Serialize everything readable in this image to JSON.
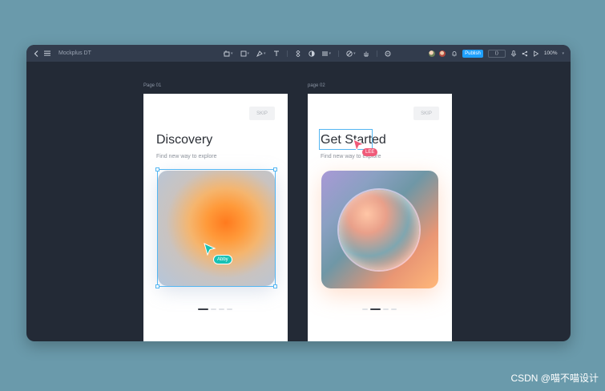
{
  "app": {
    "name": "Mockplus DT",
    "publish_label": "Publish",
    "code_label": "⟨⟩",
    "zoom": "100%"
  },
  "toolbar_icons": [
    "back-icon",
    "menu-icon",
    "frame-icon",
    "rect-icon",
    "pen-icon",
    "text-icon",
    "component-icon",
    "contrast-icon",
    "layers-icon",
    "slash-icon",
    "hand-icon",
    "comment-icon",
    "bell-icon",
    "mic-icon",
    "share-icon",
    "play-icon"
  ],
  "pages": [
    {
      "label": "Page 01",
      "skip": "SKIP",
      "title": "Discovery",
      "subtitle": "Find new way to explore",
      "cursor_user": "Abby",
      "cursor_color": "#18c1b4"
    },
    {
      "label": "page 02",
      "skip": "SKIP",
      "title": "Get Started",
      "subtitle": "Find new way to explore",
      "cursor_user": "LEE",
      "cursor_color": "#f05a78"
    }
  ],
  "watermark": "CSDN @喵不喵设计",
  "colors": {
    "selection": "#54b6f2",
    "publish": "#1ea0ff"
  }
}
